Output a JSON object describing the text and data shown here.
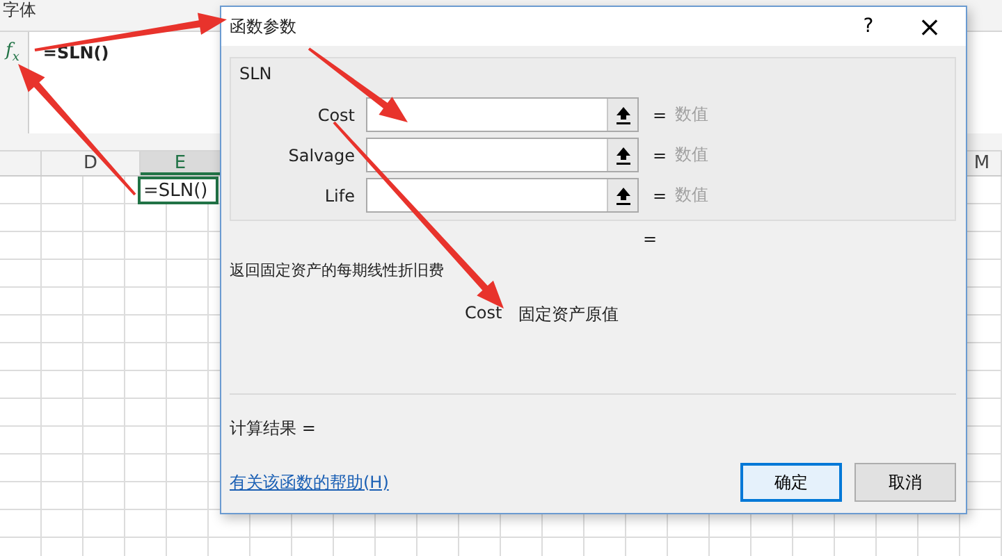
{
  "ribbon": {
    "group_label": "字体"
  },
  "formula_bar": {
    "insert_function": "f$_{x}$",
    "formula": "=SLN()"
  },
  "sheet": {
    "columns": [
      {
        "label": "D",
        "selected": false
      },
      {
        "label": "E",
        "selected": true
      },
      {
        "label": "M",
        "selected": false
      }
    ],
    "active_cell": "=SLN()"
  },
  "dialog": {
    "title": "函数参数",
    "help_button": "?",
    "close_button": "×",
    "function_name": "SLN",
    "arguments": [
      {
        "label": "Cost",
        "equals": "=",
        "value_hint": "数值"
      },
      {
        "label": "Salvage",
        "equals": "=",
        "value_hint": "数值"
      },
      {
        "label": "Life",
        "equals": "=",
        "value_hint": "数值"
      }
    ],
    "result_equals": "=",
    "description": "返回固定资产的每期线性折旧费",
    "argument_help": {
      "name": "Cost",
      "text": "固定资产原值"
    },
    "calc_result": "计算结果 =",
    "help_link": "有关该函数的帮助(H)",
    "buttons": [
      {
        "label": "确定",
        "default": true
      },
      {
        "label": "取消",
        "default": false
      }
    ]
  }
}
